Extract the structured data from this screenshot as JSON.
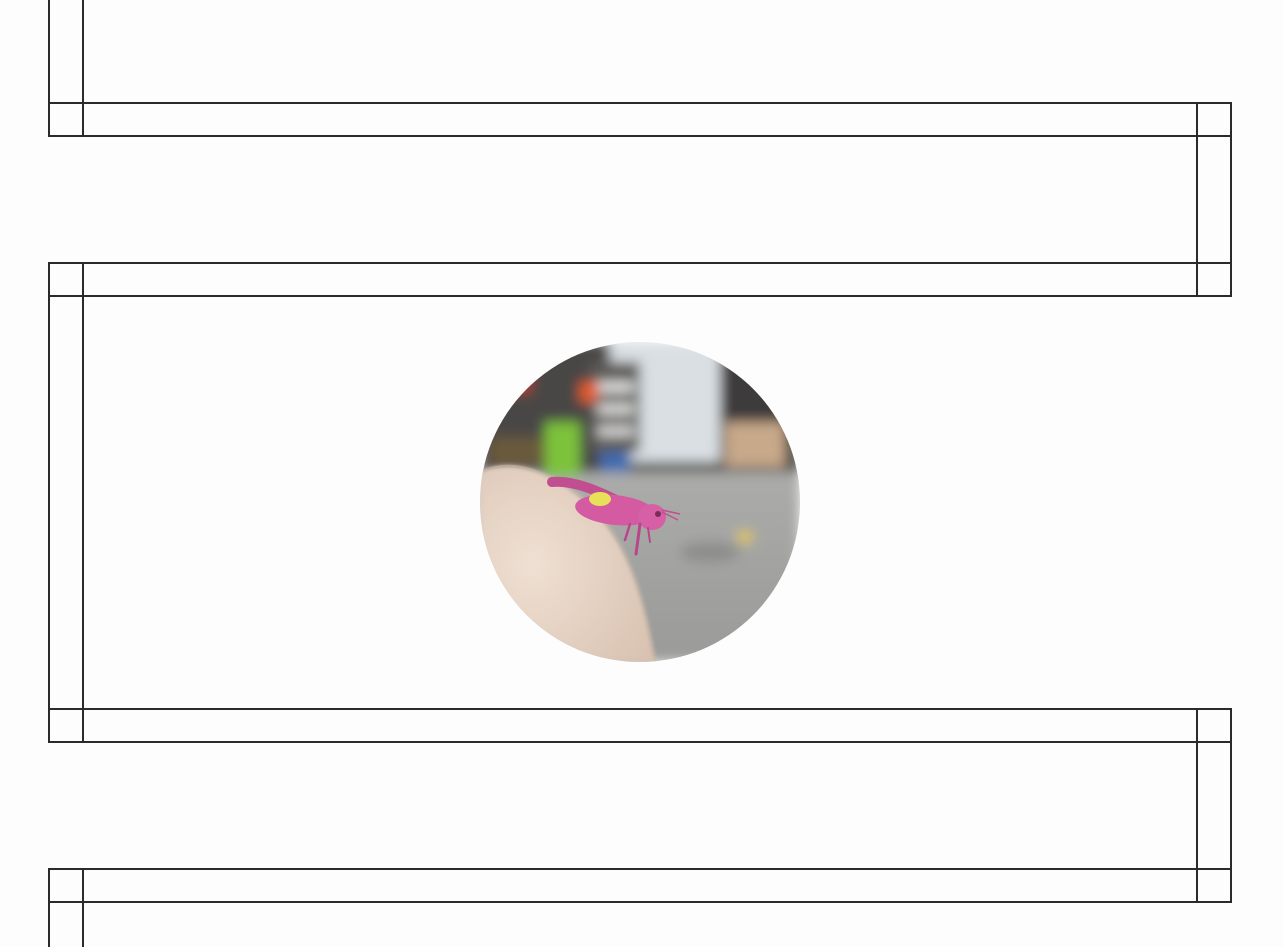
{
  "decoration": {
    "line_color": "#2b2b2b",
    "background": "#fdfdfd"
  },
  "photo": {
    "subject": "pink-grasshopper-on-finger",
    "shape": "circle",
    "colors": {
      "insect": "#d45aa2",
      "insect_patch": "#e8e05a",
      "skin": "#ead7c8",
      "floor": "#a9aaa7",
      "background_dark": "#3f3c39",
      "wall": "#d7dde0"
    }
  }
}
